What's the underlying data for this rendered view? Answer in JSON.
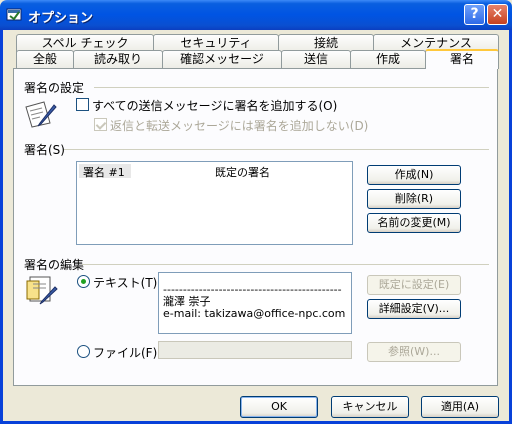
{
  "window": {
    "title": "オプション",
    "help_glyph": "?",
    "close_glyph": "✕"
  },
  "tabs_back": [
    "スペル チェック",
    "セキュリティ",
    "接続",
    "メンテナンス"
  ],
  "tabs_front": [
    "全般",
    "読み取り",
    "確認メッセージ",
    "送信",
    "作成",
    "署名"
  ],
  "settings": {
    "heading": "署名の設定",
    "add_all": "すべての送信メッセージに署名を追加する(O)",
    "no_reply": "返信と転送メッセージには署名を追加しない(D)"
  },
  "signatures": {
    "heading": "署名(S)",
    "columns": [
      "署名 #1",
      "既定の署名"
    ],
    "new_button": "作成(N)",
    "remove_button": "削除(R)",
    "rename_button": "名前の変更(M)"
  },
  "edit": {
    "heading": "署名の編集",
    "text_option": "テキスト(T)",
    "file_option": "ファイル(F)",
    "text_lines": [
      "---------------------------------------------",
      "瀧澤 崇子",
      "e-mail: takizawa@office-npc.com"
    ],
    "set_default_button": "既定に設定(E)",
    "advanced_button": "詳細設定(V)...",
    "browse_button": "参照(W)..."
  },
  "footer": {
    "ok": "OK",
    "cancel": "キャンセル",
    "apply": "適用(A)"
  }
}
